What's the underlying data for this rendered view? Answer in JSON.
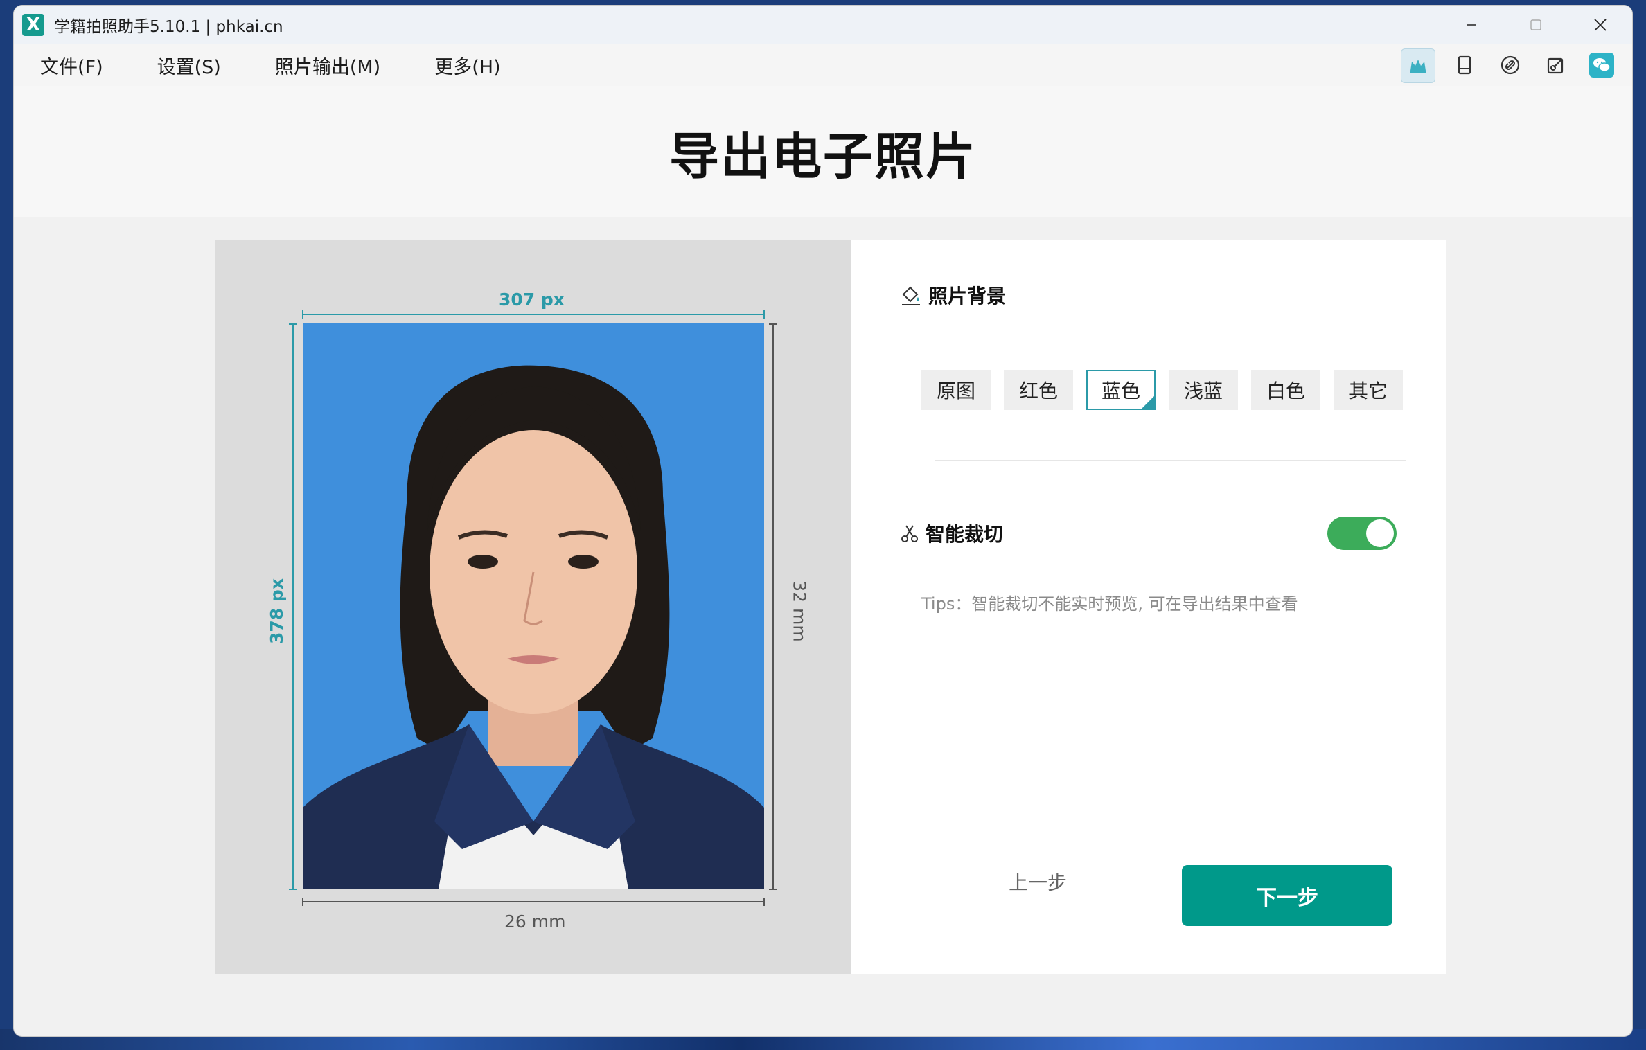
{
  "window": {
    "title": "学籍拍照助手5.10.1 | phkai.cn",
    "logo": "X"
  },
  "menu": [
    "文件(F)",
    "设置(S)",
    "照片输出(M)",
    "更多(H)"
  ],
  "toolbar_icons": [
    "crown-icon",
    "tablet-icon",
    "link-icon",
    "edit-share-icon",
    "wechat-icon"
  ],
  "page": {
    "title": "导出电子照片"
  },
  "preview": {
    "width_px": "307 px",
    "height_px": "378 px",
    "width_mm": "26 mm",
    "height_mm": "32 mm",
    "background_color": "#3f8fdc"
  },
  "settings": {
    "background_section": "照片背景",
    "background_options": [
      "原图",
      "红色",
      "蓝色",
      "浅蓝",
      "白色",
      "其它"
    ],
    "selected_background": "蓝色",
    "smart_crop_label": "智能裁切",
    "smart_crop_enabled": true,
    "tips": "Tips：智能裁切不能实时预览, 可在导出结果中查看"
  },
  "nav": {
    "prev": "上一步",
    "next": "下一步"
  },
  "colors": {
    "accent": "#00998a",
    "dimension": "#2b9aa8",
    "toggle_on": "#3cac5a"
  }
}
